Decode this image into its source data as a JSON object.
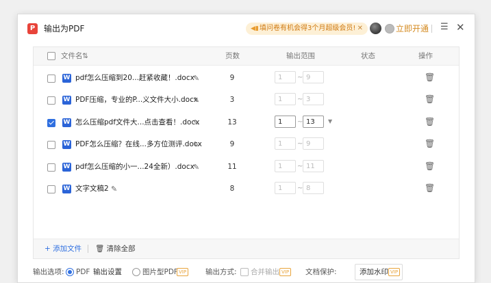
{
  "window": {
    "app_logo": "P",
    "title": "输出为PDF",
    "promo_text": "填问卷有机会得3个月超级会员!",
    "promo_close": "✕",
    "open_label": "立即开通",
    "menu_glyph": "☰",
    "close_glyph": "✕"
  },
  "table": {
    "headers": {
      "filename": "文件名",
      "sort": "⇅",
      "pages": "页数",
      "range": "输出范围",
      "status": "状态",
      "actions": "操作"
    },
    "rows": [
      {
        "name": "pdf怎么压缩到20...赶紧收藏！.docx",
        "pages": "9",
        "from": "1",
        "to": "9",
        "checked": false
      },
      {
        "name": "PDF压缩，专业的P...义文件大小.docx",
        "pages": "3",
        "from": "1",
        "to": "3",
        "checked": false
      },
      {
        "name": "怎么压缩pdf文件大...点击查看！.docx",
        "pages": "13",
        "from": "1",
        "to": "13",
        "checked": true
      },
      {
        "name": "PDF怎么压缩？在线...多方位测评.docx",
        "pages": "9",
        "from": "1",
        "to": "9",
        "checked": false
      },
      {
        "name": "pdf怎么压缩的小一...24全新）.docx",
        "pages": "11",
        "from": "1",
        "to": "11",
        "checked": false
      },
      {
        "name": "文字文稿2",
        "pages": "8",
        "from": "1",
        "to": "8",
        "checked": false
      }
    ],
    "word_icon": "W",
    "range_sep": "~",
    "footer": {
      "add_file": "+ 添加文件",
      "clear_all": "清除全部"
    }
  },
  "options": {
    "output_label": "输出选项:",
    "pdf_label": "PDF",
    "output_settings": "输出设置",
    "image_pdf_label": "图片型PDF",
    "vip": "VIP",
    "output_mode_label": "输出方式:",
    "merge_label": "合并输出",
    "protect_label": "文档保护:",
    "watermark_label": "添加水印"
  }
}
